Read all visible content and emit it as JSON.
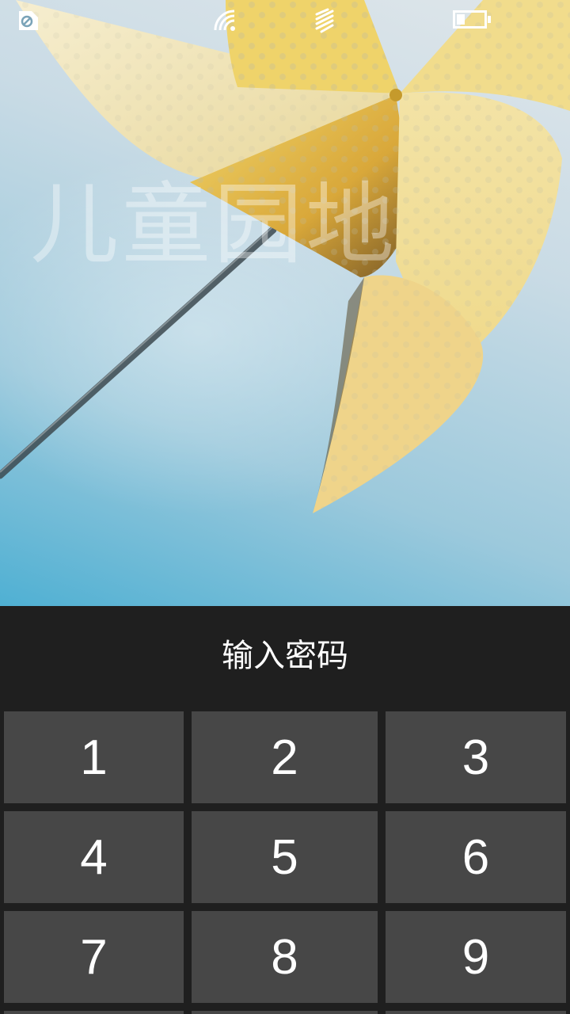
{
  "status_bar": {
    "icons": [
      "sim-card-icon",
      "wifi-icon",
      "vibrate-icon",
      "battery-icon"
    ],
    "battery_level_fraction": 0.3
  },
  "wallpaper": {
    "title": "儿童园地"
  },
  "lock": {
    "prompt": "输入密码"
  },
  "keypad": {
    "keys": [
      "1",
      "2",
      "3",
      "4",
      "5",
      "6",
      "7",
      "8",
      "9"
    ]
  },
  "colors": {
    "panel_background": "#1f1f1f",
    "key_background": "#474747",
    "text": "#ffffff"
  }
}
